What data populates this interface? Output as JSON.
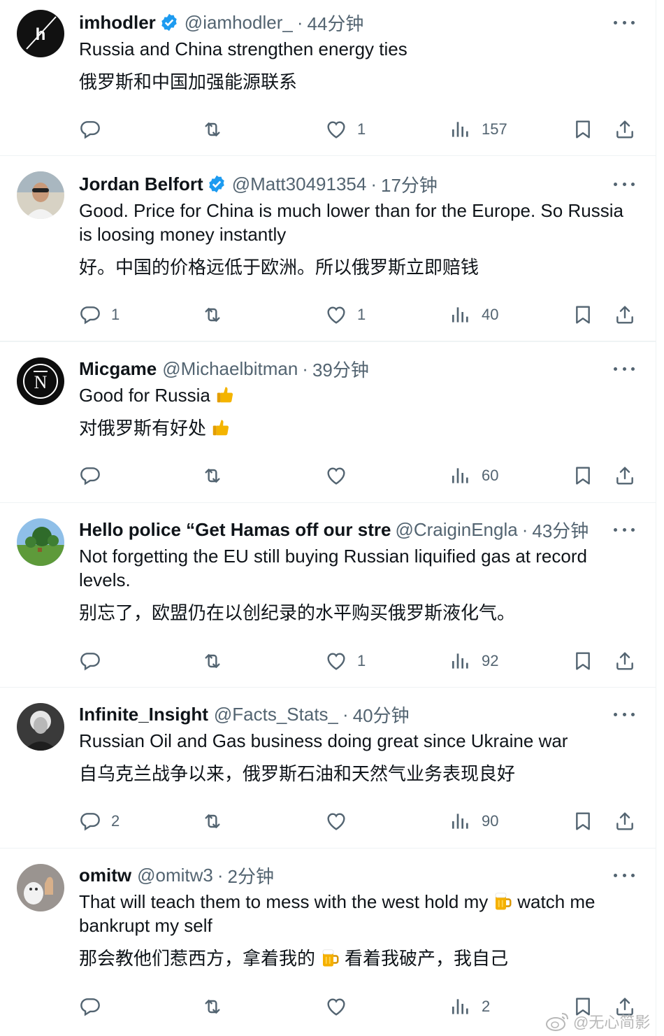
{
  "tweets": [
    {
      "name": "imhodler",
      "verified": true,
      "handle": "@iamhodler_",
      "time": "44分钟",
      "text": "Russia and China strengthen energy ties",
      "translation": "俄罗斯和中国加强能源联系",
      "replies": "",
      "likes": "1",
      "views": "157"
    },
    {
      "name": "Jordan Belfort",
      "verified": true,
      "handle": "@Matt30491354",
      "time": "17分钟",
      "text": "Good. Price for China is much lower than for the Europe. So Russia is loosing money instantly",
      "translation": "好。中国的价格远低于欧洲。所以俄罗斯立即赔钱",
      "replies": "1",
      "likes": "1",
      "views": "40"
    },
    {
      "name": "Micgame",
      "verified": false,
      "handle": "@Michaelbitman",
      "time": "39分钟",
      "text": "Good for Russia",
      "text_emoji": "thumbs-up",
      "translation": "对俄罗斯有好处",
      "translation_emoji": "thumbs-up",
      "replies": "",
      "likes": "",
      "views": "60"
    },
    {
      "name": "Hello police “Get Hamas off our stre",
      "verified": false,
      "handle": "@CraiginEngla",
      "time": "43分钟",
      "text": "Not forgetting the EU still buying Russian liquified gas at record levels.",
      "translation": "别忘了，欧盟仍在以创纪录的水平购买俄罗斯液化气。",
      "replies": "",
      "likes": "1",
      "views": "92"
    },
    {
      "name": "Infinite_Insight",
      "verified": false,
      "handle": "@Facts_Stats_",
      "time": "40分钟",
      "text": "Russian Oil and Gas business doing great since Ukraine war",
      "translation": "自乌克兰战争以来，俄罗斯石油和天然气业务表现良好",
      "replies": "2",
      "likes": "",
      "views": "90"
    },
    {
      "name": "omitw",
      "verified": false,
      "handle": "@omitw3",
      "time": "2分钟",
      "text_before": "That will teach them to mess with the west hold my",
      "text_after": "watch me bankrupt my self",
      "text_emoji": "beer-mug",
      "translation_before": "那会教他们惹西方，拿着我的",
      "translation_after": "看着我破产，我自己",
      "translation_emoji": "beer-mug",
      "replies": "",
      "likes": "",
      "views": "2"
    }
  ],
  "watermark": "@无心简影",
  "colors": {
    "text": "#0f1419",
    "secondary": "#536471",
    "verified": "#1d9bf0",
    "divider": "#eff3f4"
  }
}
